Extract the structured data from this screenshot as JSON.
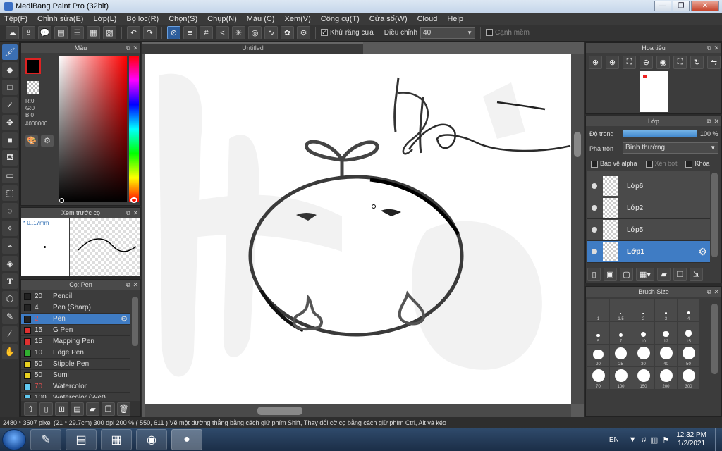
{
  "window": {
    "title": "MediBang Paint Pro (32bit)",
    "minimize": "—",
    "maximize": "❐",
    "close": "✕"
  },
  "menu": [
    "Tệp(F)",
    "Chỉnh sửa(E)",
    "Lớp(L)",
    "Bộ lọc(R)",
    "Chọn(S)",
    "Chụp(N)",
    "Màu (C)",
    "Xem(V)",
    "Công cụ(T)",
    "Cửa sổ(W)",
    "Cloud",
    "Help"
  ],
  "toolbar": {
    "antialias_label": "Khử răng cưa",
    "antialias_checked": true,
    "adjust_label": "Điều chỉnh",
    "adjust_value": "40",
    "soft_edge_label": "Cạnh mềm",
    "soft_edge_checked": false
  },
  "color_panel": {
    "title": "Màu",
    "r": "R:0",
    "g": "G:0",
    "b": "B:0",
    "hex": "#000000",
    "primary_color": "#000000",
    "secondary_color": "#ffffff"
  },
  "brush_preview": {
    "title": "Xem trước cọ",
    "size": "* 0..17mm"
  },
  "brush_panel": {
    "title": "Cọ: Pen",
    "items": [
      {
        "size": "20",
        "name": "Pencil",
        "color": "#222222"
      },
      {
        "size": "4",
        "name": "Pen (Sharp)",
        "color": "#222222"
      },
      {
        "size": "2",
        "name": "Pen",
        "color": "#222222"
      },
      {
        "size": "15",
        "name": "G Pen",
        "color": "#e03030"
      },
      {
        "size": "15",
        "name": "Mapping Pen",
        "color": "#e03030"
      },
      {
        "size": "10",
        "name": "Edge Pen",
        "color": "#30b030"
      },
      {
        "size": "50",
        "name": "Stipple Pen",
        "color": "#e8d020"
      },
      {
        "size": "50",
        "name": "Sumi",
        "color": "#e8d020"
      },
      {
        "size": "70",
        "name": "Watercolor",
        "color": "#60c8f0"
      },
      {
        "size": "100",
        "name": "Watercolor (Wet)",
        "color": "#60c8f0"
      }
    ]
  },
  "canvas": {
    "tab_title": "Untitled"
  },
  "navigator": {
    "title": "Hoa tiêu"
  },
  "layers": {
    "title": "Lớp",
    "opacity_label": "Độ trong",
    "opacity_value": "100 %",
    "opacity_fraction": 1.0,
    "blend_label": "Pha trộn",
    "blend_value": "Bình thường",
    "protect_alpha": "Bảo vệ alpha",
    "clipping": "Xén bớt",
    "lock": "Khóa",
    "items": [
      {
        "name": "Lớp6"
      },
      {
        "name": "Lớp2"
      },
      {
        "name": "Lớp5"
      },
      {
        "name": "Lớp1"
      }
    ]
  },
  "brush_size": {
    "title": "Brush Size",
    "sizes": [
      "1",
      "1.5",
      "2",
      "3",
      "4",
      "5",
      "7",
      "10",
      "12",
      "15",
      "20",
      "25",
      "30",
      "40",
      "50",
      "70",
      "100",
      "150",
      "200",
      "300"
    ]
  },
  "status": {
    "text": "2480 * 3507 pixel   (21 * 29.7cm)   300 dpi   200 %   ( 550, 611 )   Vẽ một đường thẳng bằng cách giữ phím Shift, Thay đổi cỡ cọ bằng cách giữ phím Ctrl, Alt và kéo"
  },
  "taskbar": {
    "language": "EN",
    "time": "12:32 PM",
    "date": "1/2/2021"
  }
}
